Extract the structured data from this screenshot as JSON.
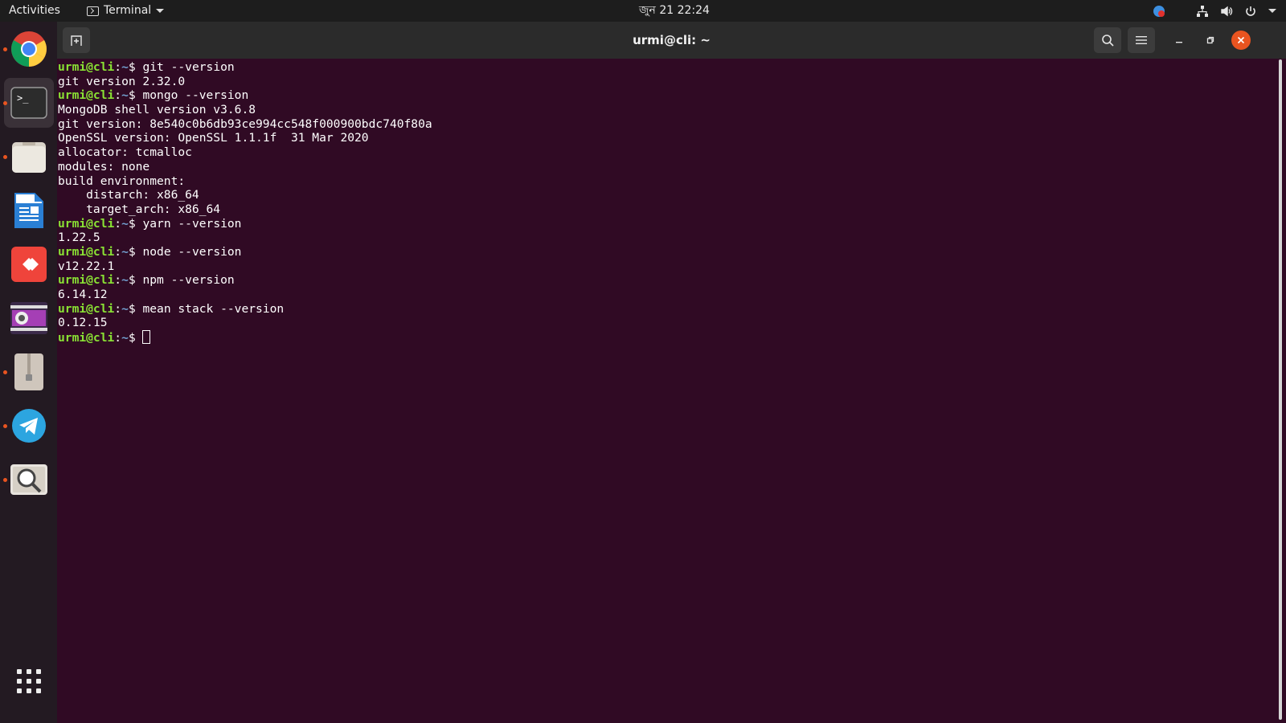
{
  "topbar": {
    "activities": "Activities",
    "app_menu": "Terminal",
    "clock": "জুন 21  22:24"
  },
  "dock": {
    "items": [
      {
        "name": "Google Chrome",
        "icon": "chrome-icon",
        "running": true
      },
      {
        "name": "Terminal",
        "icon": "terminal-icon",
        "running": true,
        "active": true
      },
      {
        "name": "Files",
        "icon": "files-icon",
        "running": true
      },
      {
        "name": "LibreOffice Writer",
        "icon": "writer-icon",
        "running": false
      },
      {
        "name": "AnyDesk",
        "icon": "anydesk-icon",
        "running": false
      },
      {
        "name": "Video Player",
        "icon": "video-icon",
        "running": false
      },
      {
        "name": "Archive Manager",
        "icon": "archive-icon",
        "running": true
      },
      {
        "name": "Telegram",
        "icon": "telegram-icon",
        "running": true
      },
      {
        "name": "Image Viewer",
        "icon": "viewer-icon",
        "running": true
      },
      {
        "name": "Show Applications",
        "icon": "app-grid-icon",
        "running": false
      }
    ]
  },
  "window": {
    "title": "urmi@cli: ~"
  },
  "terminal": {
    "prompt_user": "urmi@cli",
    "prompt_path": "~",
    "lines": [
      {
        "prompt": true,
        "cmd": "git --version"
      },
      {
        "prompt": false,
        "text": "git version 2.32.0"
      },
      {
        "prompt": true,
        "cmd": "mongo --version"
      },
      {
        "prompt": false,
        "text": "MongoDB shell version v3.6.8"
      },
      {
        "prompt": false,
        "text": "git version: 8e540c0b6db93ce994cc548f000900bdc740f80a"
      },
      {
        "prompt": false,
        "text": "OpenSSL version: OpenSSL 1.1.1f  31 Mar 2020"
      },
      {
        "prompt": false,
        "text": "allocator: tcmalloc"
      },
      {
        "prompt": false,
        "text": "modules: none"
      },
      {
        "prompt": false,
        "text": "build environment:"
      },
      {
        "prompt": false,
        "text": "    distarch: x86_64"
      },
      {
        "prompt": false,
        "text": "    target_arch: x86_64"
      },
      {
        "prompt": true,
        "cmd": "yarn --version"
      },
      {
        "prompt": false,
        "text": "1.22.5"
      },
      {
        "prompt": true,
        "cmd": "node --version"
      },
      {
        "prompt": false,
        "text": "v12.22.1"
      },
      {
        "prompt": true,
        "cmd": "npm --version"
      },
      {
        "prompt": false,
        "text": "6.14.12"
      },
      {
        "prompt": true,
        "cmd": "mean stack --version"
      },
      {
        "prompt": false,
        "text": "0.12.15"
      },
      {
        "prompt": true,
        "cmd": "",
        "cursor": true
      }
    ]
  },
  "colors": {
    "terminal_bg": "#300a24",
    "prompt_user": "#8ae234",
    "prompt_path": "#729fcf",
    "accent": "#e95420"
  }
}
